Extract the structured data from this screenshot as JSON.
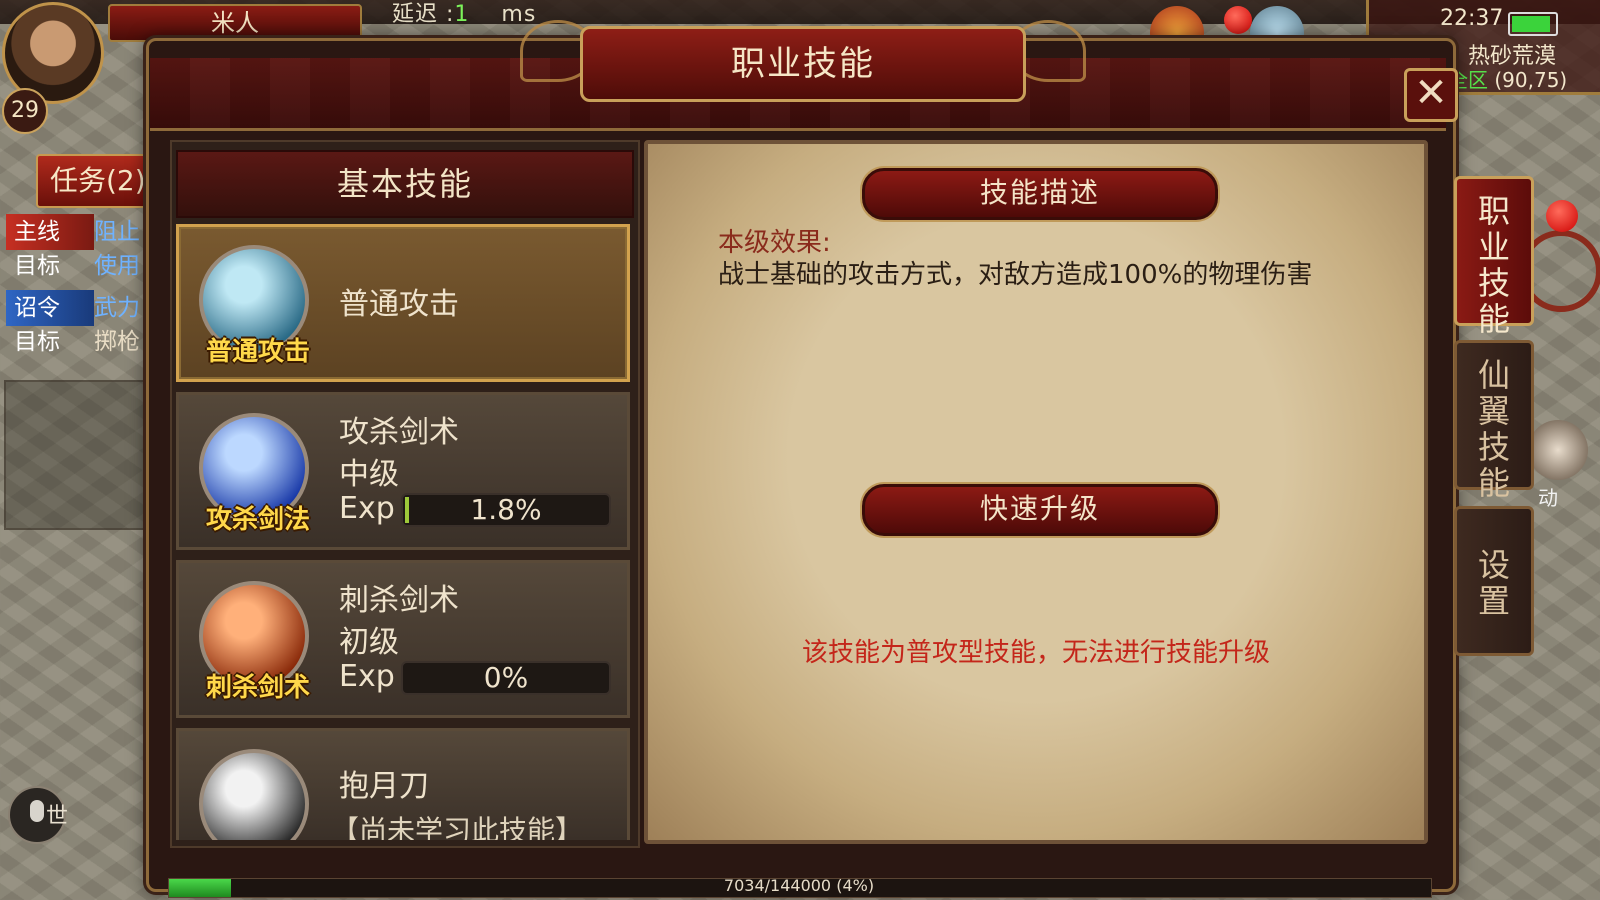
{
  "hud": {
    "character_name": "米人",
    "latency_label": "延迟 :",
    "latency_value": "1",
    "latency_unit": "ms",
    "level": "29",
    "quest_tab": "任务(2)",
    "quests": [
      {
        "tag": "主线",
        "value": "阻止"
      },
      {
        "tag": "目标",
        "value": "使用"
      },
      {
        "tag": "诏令",
        "value": "武力"
      },
      {
        "tag": "目标",
        "value": "掷枪"
      }
    ],
    "chat_channel": "世",
    "clock": "22:37",
    "battery_level": 0.9,
    "map_name": "热砂荒漠",
    "map_zone": "全区",
    "map_coords": "(90,75)",
    "exp_text": "7034/144000 (4%)",
    "exp_fraction": 0.049,
    "right_icon_label": "动"
  },
  "window": {
    "title": "职业技能",
    "close_symbol": "✕",
    "list_header": "基本技能",
    "skills": [
      {
        "icon_caption": "普通攻击",
        "name": "普通攻击",
        "selected": true,
        "icon_colors": [
          "#bfe8f4",
          "#2a6a86"
        ]
      },
      {
        "icon_caption": "攻杀剑法",
        "name": "攻杀剑术",
        "rank": "中级",
        "exp_label": "Exp",
        "exp_pct": "1.8%",
        "exp_fraction": 0.018,
        "icon_colors": [
          "#bcd8ff",
          "#1a3aa8"
        ]
      },
      {
        "icon_caption": "刺杀剑术",
        "name": "刺杀剑术",
        "rank": "初级",
        "exp_label": "Exp",
        "exp_pct": "0%",
        "exp_fraction": 0,
        "icon_colors": [
          "#ffb07a",
          "#8a2a0a"
        ]
      },
      {
        "name": "抱月刀",
        "unlearned": "【尚未学习此技能】",
        "icon_colors": [
          "#f2f2f2",
          "#2a2a2a"
        ]
      }
    ],
    "describe_ribbon": "技能描述",
    "effect_label": "本级效果:",
    "effect_text": "战士基础的攻击方式，对敌方造成100%的物理伤害",
    "upgrade_ribbon": "快速升级",
    "upgrade_notice": "该技能为普攻型技能，无法进行技能升级",
    "side_tabs": [
      "职业技能",
      "仙翼技能",
      "设置"
    ]
  },
  "colors": {
    "panel_red": "#8a1a14",
    "gold_border": "#c9a05a",
    "parchment": "#d9c6a0",
    "exp_green": "#9dc83a",
    "notice_red": "#c4261a"
  }
}
